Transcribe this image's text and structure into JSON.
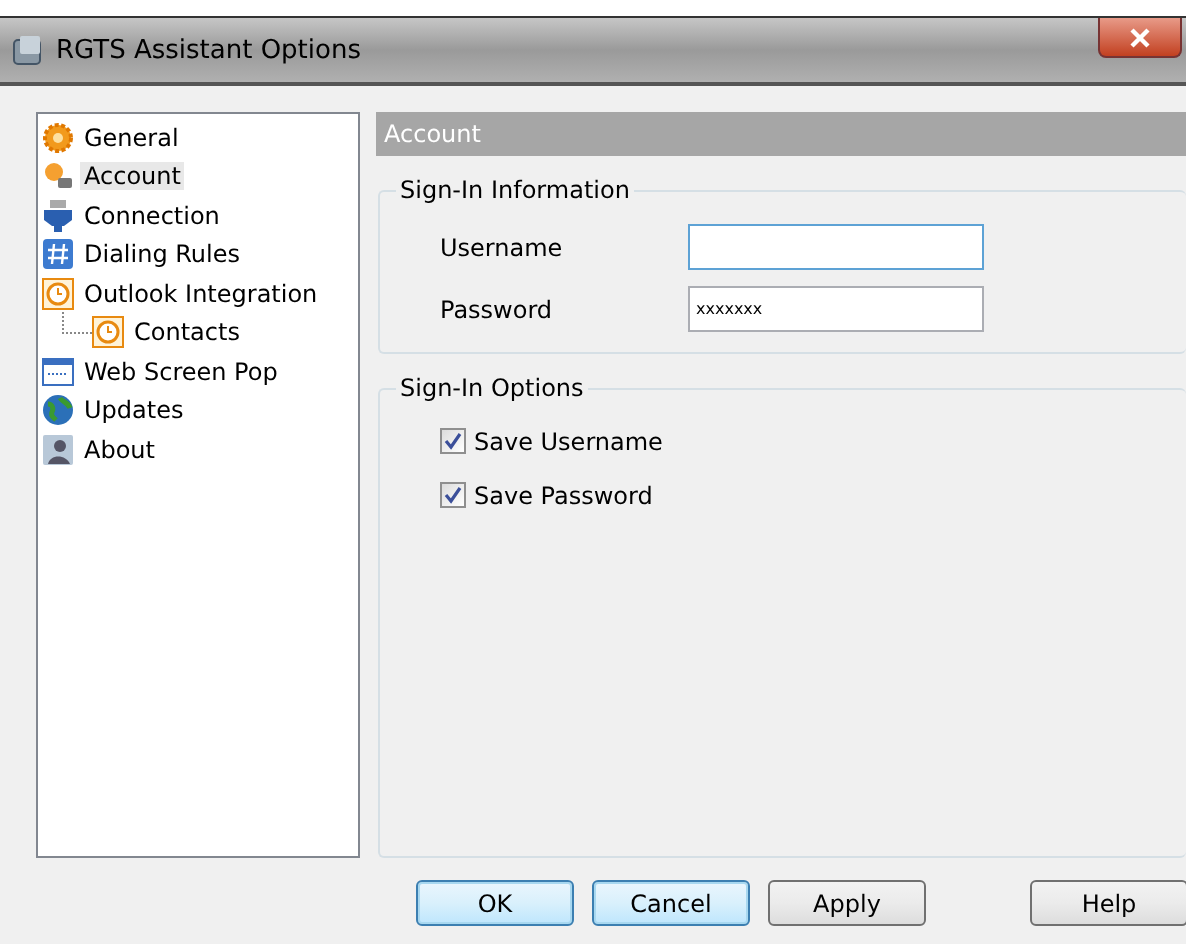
{
  "window": {
    "title": "RGTS Assistant Options"
  },
  "sidebar": {
    "items": [
      {
        "label": "General",
        "selected": false
      },
      {
        "label": "Account",
        "selected": true
      },
      {
        "label": "Connection",
        "selected": false
      },
      {
        "label": "Dialing Rules",
        "selected": false
      },
      {
        "label": "Outlook Integration",
        "selected": false,
        "children": [
          {
            "label": "Contacts",
            "selected": false
          }
        ]
      },
      {
        "label": "Web Screen Pop",
        "selected": false
      },
      {
        "label": "Updates",
        "selected": false
      },
      {
        "label": "About",
        "selected": false
      }
    ]
  },
  "panel": {
    "title": "Account",
    "groups": [
      {
        "title": "Sign-In Information",
        "fields": [
          {
            "label": "Username",
            "focused": true
          },
          {
            "label": "Password",
            "value": "xxxxxxx",
            "focused": false
          }
        ]
      },
      {
        "title": "Sign-In Options",
        "checkboxes": [
          {
            "label": "Save Username",
            "checked": true
          },
          {
            "label": "Save Password",
            "checked": true
          }
        ]
      }
    ]
  },
  "buttons": [
    {
      "label": "OK",
      "default": true
    },
    {
      "label": "Cancel",
      "default": true
    },
    {
      "label": "Apply",
      "default": false
    },
    {
      "label": "Help",
      "default": false
    }
  ]
}
